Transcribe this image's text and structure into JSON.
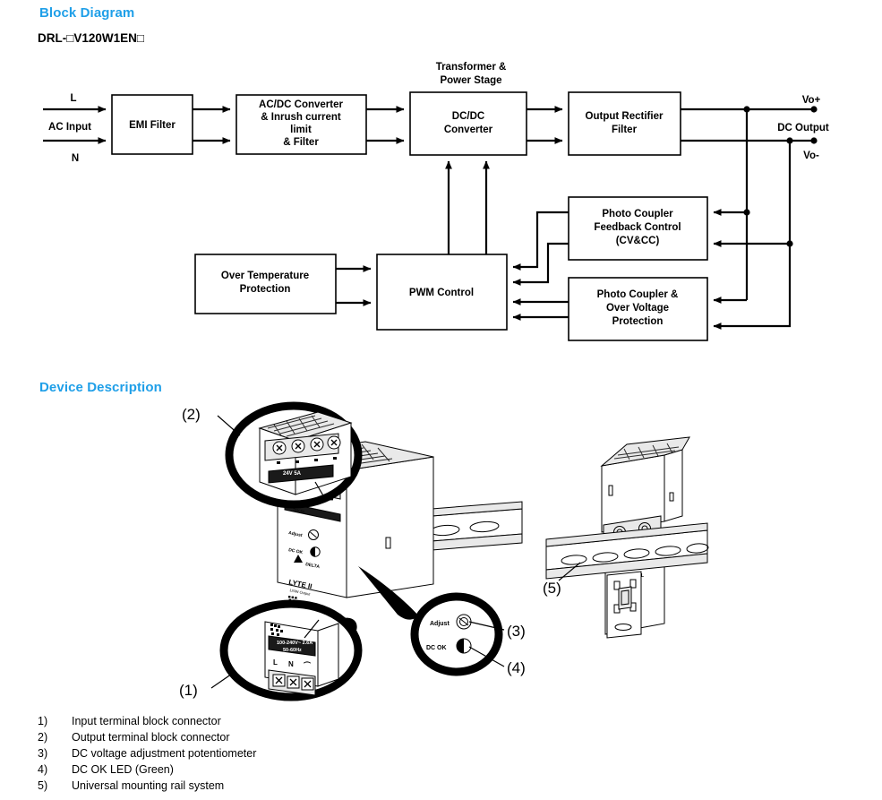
{
  "block_section": {
    "title": "Block Diagram",
    "model_number": "DRL-□V120W1EN□",
    "boxes": {
      "emi_filter": "EMI Filter",
      "acdc_l1": "AC/DC Converter",
      "acdc_l2": "& Inrush current",
      "acdc_l3": "limit",
      "acdc_l4": "& Filter",
      "dcdc_l1": "DC/DC",
      "dcdc_l2": "Converter",
      "rectifier_l1": "Output Rectifier",
      "rectifier_l2": "Filter",
      "otp_l1": "Over Temperature",
      "otp_l2": "Protection",
      "pwm": "PWM Control",
      "pcfb_l1": "Photo Coupler",
      "pcfb_l2": "Feedback Control",
      "pcfb_l3": "(CV&CC)",
      "pcov_l1": "Photo Coupler &",
      "pcov_l2": "Over Voltage",
      "pcov_l3": "Protection"
    },
    "labels": {
      "transformer_l1": "Transformer &",
      "transformer_l2": "Power Stage",
      "line": "L",
      "neutral": "N",
      "ac_input": "AC Input",
      "vo_plus": "Vo+",
      "vo_minus": "Vo-",
      "dc_output": "DC Output"
    }
  },
  "device_section": {
    "title": "Device Description",
    "callouts": {
      "c1": "(1)",
      "c2": "(2)",
      "c3": "(3)",
      "c4": "(4)",
      "c5": "(5)"
    },
    "device_markings": {
      "brand": "DELTA",
      "product_line": "LYTE II",
      "output_rating": "120W Output",
      "adjust_label": "Adjust",
      "dc_ok_label": "DC OK",
      "input_rating_l1": "100-240V~ 2.6A",
      "input_rating_l2": "50-60Hz",
      "terminal_l": "L",
      "terminal_n": "N",
      "terminal_ground": "⏚",
      "output_label": "24V  5A"
    }
  },
  "legend": {
    "items": [
      {
        "index": "1)",
        "text": "Input terminal block connector"
      },
      {
        "index": "2)",
        "text": "Output terminal block connector"
      },
      {
        "index": "3)",
        "text": "DC voltage adjustment potentiometer"
      },
      {
        "index": "4)",
        "text": "DC OK LED (Green)"
      },
      {
        "index": "5)",
        "text": "Universal mounting rail system"
      }
    ]
  },
  "colors": {
    "heading_blue": "#1f9fe8",
    "body_black": "#000000"
  }
}
